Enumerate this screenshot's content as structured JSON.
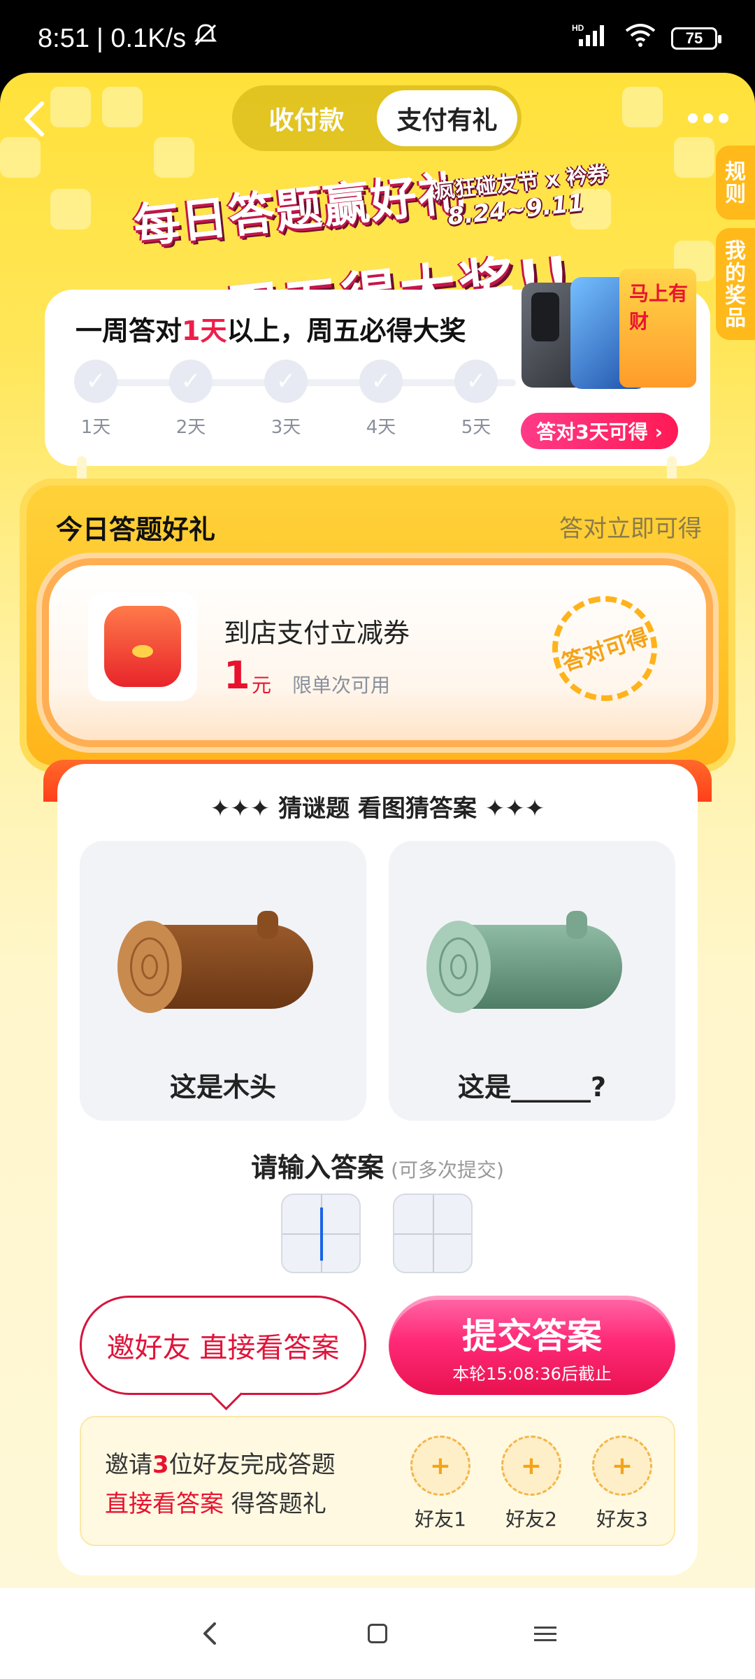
{
  "status_bar": {
    "time": "8:51",
    "network_speed": "| 0.1K/s",
    "battery": "75",
    "icons": [
      "bell-off-icon",
      "hd-signal-icon",
      "wifi-icon",
      "battery-icon"
    ]
  },
  "header": {
    "tabs": [
      "收付款",
      "支付有礼"
    ],
    "active_tab": "支付有礼",
    "side_tabs": [
      "规则",
      "我的奖品"
    ]
  },
  "banner": {
    "line1": "每日答题赢好礼",
    "line2": "周五得大奖!!",
    "event": "疯狂碰友节 x 衿券",
    "dates": "8.24~9.11"
  },
  "weekly": {
    "title_prefix": "一周答对",
    "title_highlight": "1天",
    "title_suffix": "以上，周五必得大奖",
    "days": [
      "1天",
      "2天",
      "3天",
      "4天",
      "5天"
    ],
    "prize_card_text": "马上有财",
    "prize_button": "答对3天可得 ›"
  },
  "today": {
    "title": "今日答题好礼",
    "note": "答对立即可得",
    "coupon": {
      "name": "到店支付立减券",
      "amount": "1",
      "unit": "元",
      "limit": "限单次可用",
      "stamp": "答对可得"
    }
  },
  "quiz": {
    "title": "✦✦✦ 猜谜题 看图猜答案 ✦✦✦",
    "cards": [
      {
        "caption": "这是木头"
      },
      {
        "caption": "这是______?"
      }
    ],
    "input_title": "请输入答案",
    "input_hint": "(可多次提交)",
    "invite_button": "邀好友 直接看答案",
    "submit_button": "提交答案",
    "submit_sub": "本轮15:08:36后截止"
  },
  "friends": {
    "line1_prefix": "邀请",
    "line1_count": "3",
    "line1_suffix": "位好友完成答题",
    "line2_highlight": "直接看答案",
    "line2_suffix": " 得答题礼",
    "slots": [
      "好友1",
      "好友2",
      "好友3"
    ],
    "slot_symbol": "+"
  },
  "colors": {
    "accent_red": "#e8122f",
    "background_yellow": "#ffe13a",
    "submit_pink": "#ff2a78"
  }
}
